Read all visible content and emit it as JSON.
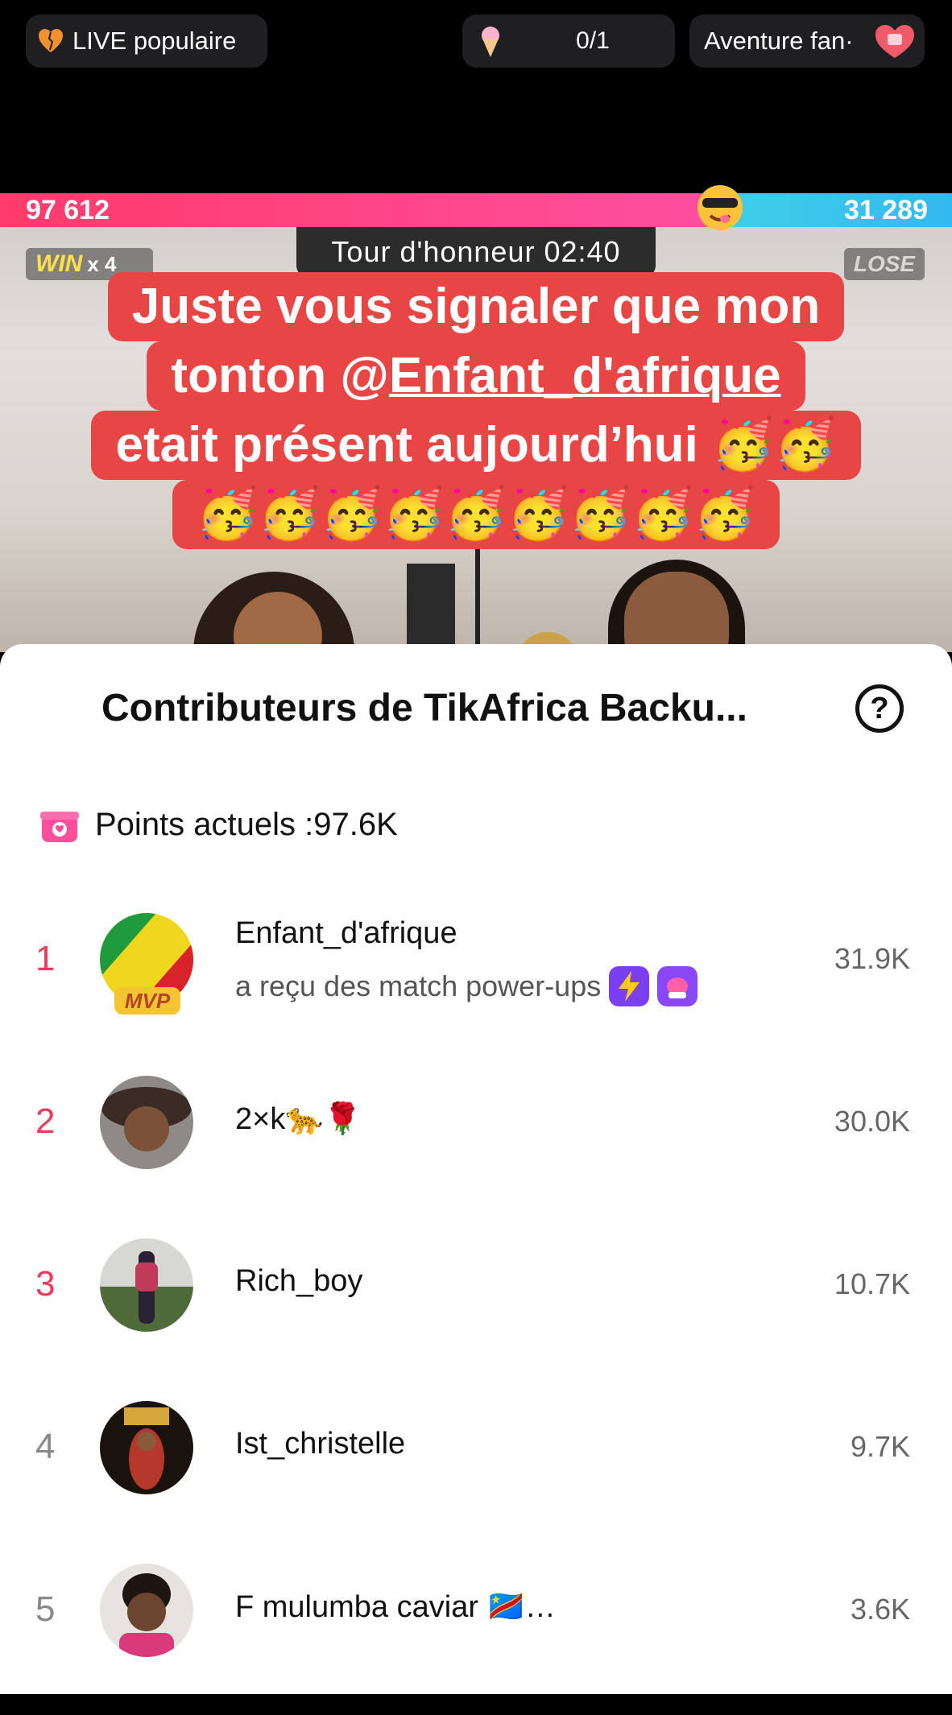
{
  "topbar": {
    "live_label": "LIVE populaire",
    "goal_label": "0/1",
    "adventure_label": "Aventure fan·"
  },
  "battle": {
    "left_score": "97 612",
    "right_score": "31 289",
    "win_word": "WIN",
    "win_mult": "x 4",
    "lose_word": "LOSE",
    "timer": "Tour d'honneur 02:40"
  },
  "caption": {
    "line1": "Juste vous signaler que  mon",
    "line2_a": "tonton @",
    "line2_b": "Enfant_d'afrique",
    "line3": "etait présent aujourd’hui 🥳🥳",
    "line4": "🥳🥳🥳🥳🥳🥳🥳🥳🥳"
  },
  "sheet": {
    "title": "Contributeurs de TikAfrica Backu...",
    "help_label": "?",
    "points_label": "Points actuels :97.6K"
  },
  "contributors": [
    {
      "rank": "1",
      "name": "Enfant_d'afrique",
      "sub": "a reçu des match power-ups",
      "points": "31.9K",
      "badge": "MVP"
    },
    {
      "rank": "2",
      "name": "2×k🐆🌹",
      "points": "30.0K"
    },
    {
      "rank": "3",
      "name": "Rich_boy",
      "points": "10.7K"
    },
    {
      "rank": "4",
      "name": "Ist_christelle",
      "points": "9.7K"
    },
    {
      "rank": "5",
      "name": "F  mulumba caviar 🇨🇩…",
      "points": "3.6K"
    }
  ],
  "colors": {
    "accent_red": "#e84545",
    "rank_pink": "#ee3a5d",
    "score_pink": "#ff3b6b",
    "score_blue": "#34b8f0"
  },
  "icons": {
    "live": "orange-heart-icon",
    "goal": "ice-cream-icon",
    "adventure": "heart-gift-icon",
    "battle": "cool-emoji-icon",
    "points": "gift-box-icon",
    "help": "question-icon",
    "powerups": [
      "lightning-icon",
      "glove-icon"
    ]
  }
}
